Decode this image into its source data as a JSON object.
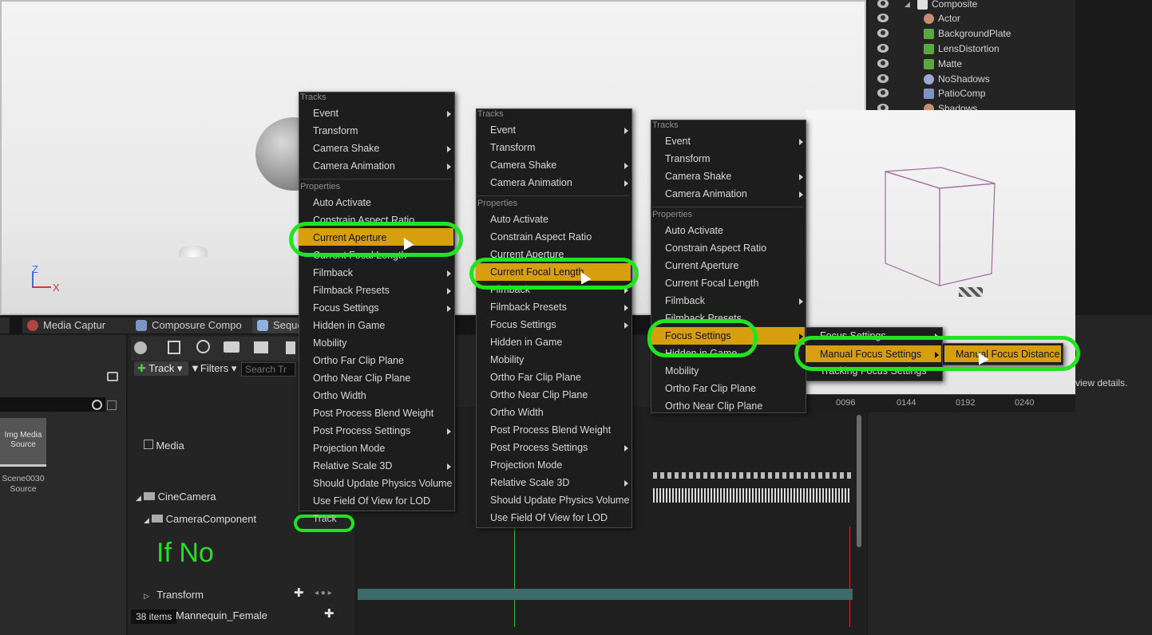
{
  "outliner": {
    "items": [
      "Composite",
      "Actor",
      "BackgroundPlate",
      "LensDistortion",
      "Matte",
      "NoShadows",
      "PatioComp",
      "Shadows"
    ]
  },
  "viewport": {
    "axis_z": "Z",
    "axis_x": "X"
  },
  "tabs": [
    "Media Captur",
    "Composure Compo",
    "Seque"
  ],
  "left_panel": {
    "asset_label": "Img Media Source",
    "asset_name": "Scene0030 Source",
    "items_count": "38 items"
  },
  "sequencer": {
    "track_button": "Track",
    "filters_button": "Filters",
    "search_placeholder": "Search Tr",
    "rows": [
      "Media",
      "CineCamera",
      "CameraComponent",
      "Transform",
      "Mannequin_Female"
    ],
    "annotation": "If No",
    "track_small": "Track",
    "timeline_ticks": [
      "0096",
      "0144",
      "0192",
      "0240"
    ],
    "details_hint": "view details."
  },
  "menu1": {
    "head_tracks": "Tracks",
    "tracks": [
      "Event",
      "Transform",
      "Camera Shake",
      "Camera Animation"
    ],
    "head_props": "Properties",
    "props": [
      "Auto Activate",
      "Constrain Aspect Ratio",
      "Current Aperture",
      "Current Focal Length",
      "Filmback",
      "Filmback Presets",
      "Focus Settings",
      "Hidden in Game",
      "Mobility",
      "Ortho Far Clip Plane",
      "Ortho Near Clip Plane",
      "Ortho Width",
      "Post Process Blend Weight",
      "Post Process Settings",
      "Projection Mode",
      "Relative Scale 3D",
      "Should Update Physics Volume",
      "Use Field Of View for LOD"
    ]
  },
  "menu2": {
    "head_tracks": "Tracks",
    "tracks": [
      "Event",
      "Transform",
      "Camera Shake",
      "Camera Animation"
    ],
    "head_props": "Properties",
    "props": [
      "Auto Activate",
      "Constrain Aspect Ratio",
      "Current Aperture",
      "Current Focal Length",
      "Filmback",
      "Filmback Presets",
      "Focus Settings",
      "Hidden in Game",
      "Mobility",
      "Ortho Far Clip Plane",
      "Ortho Near Clip Plane",
      "Ortho Width",
      "Post Process Blend Weight",
      "Post Process Settings",
      "Projection Mode",
      "Relative Scale 3D",
      "Should Update Physics Volume",
      "Use Field Of View for LOD"
    ],
    "footer_track": "Track"
  },
  "menu3": {
    "head_tracks": "Tracks",
    "tracks": [
      "Event",
      "Transform",
      "Camera Shake",
      "Camera Animation"
    ],
    "head_props": "Properties",
    "props": [
      "Auto Activate",
      "Constrain Aspect Ratio",
      "Current Aperture",
      "Current Focal Length",
      "Filmback",
      "Filmback Presets",
      "Focus Settings",
      "Hidden in Game",
      "Mobility",
      "Ortho Far Clip Plane",
      "Ortho Near Clip Plane"
    ]
  },
  "submenu_focus": {
    "items": [
      "Focus Settings",
      "Manual Focus Settings",
      "Tracking Focus Settings"
    ]
  },
  "submenu_manual": {
    "items": [
      "Manual Focus Distance"
    ]
  },
  "colors": {
    "highlight": "#d79f0d",
    "annotation_green": "#22e322"
  }
}
